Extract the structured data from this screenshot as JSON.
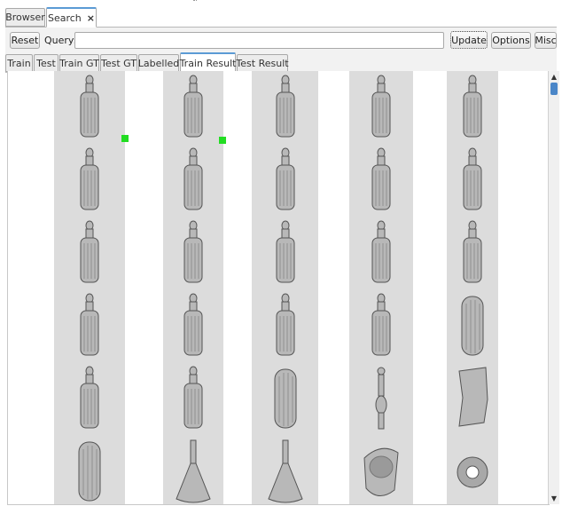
{
  "top_tabs": [
    {
      "label": "Browser",
      "active": false
    },
    {
      "label": "Search",
      "active": true,
      "close_glyph": "×"
    }
  ],
  "toolbar": {
    "reset_label": "Reset",
    "query_label": "Query:",
    "query_value": "",
    "update_label": "Update",
    "options_label": "Options",
    "misc_label": "Misc"
  },
  "result_tabs": [
    {
      "label": "Train"
    },
    {
      "label": "Test"
    },
    {
      "label": "Train GT"
    },
    {
      "label": "Test GT"
    },
    {
      "label": "Labelled"
    },
    {
      "label": "Train Result",
      "active": true
    },
    {
      "label": "Test Result"
    }
  ],
  "results": {
    "columns": 5,
    "rows": 6,
    "marker_color": "#22dd22",
    "column_bg": "#dcdcdc",
    "shapes": [
      [
        "bottle",
        "bottle",
        "bottle",
        "bottle",
        "bottle"
      ],
      [
        "bottle",
        "bottle",
        "bottle",
        "bottle",
        "bottle"
      ],
      [
        "bottle",
        "bottle",
        "bottle",
        "bottle",
        "bottle"
      ],
      [
        "bottle",
        "bottle",
        "bottle",
        "bottle",
        "cylinder"
      ],
      [
        "bottle",
        "bottle",
        "cylinder",
        "figurine",
        "fragment"
      ],
      [
        "cylinder",
        "bell",
        "bell",
        "bowl",
        "ring"
      ]
    ],
    "marked": [
      [
        0,
        0
      ],
      [
        0,
        1
      ]
    ]
  },
  "icons": {
    "scroll_up": "scroll-up-arrow-icon",
    "scroll_down": "scroll-down-arrow-icon",
    "close": "close-icon"
  }
}
